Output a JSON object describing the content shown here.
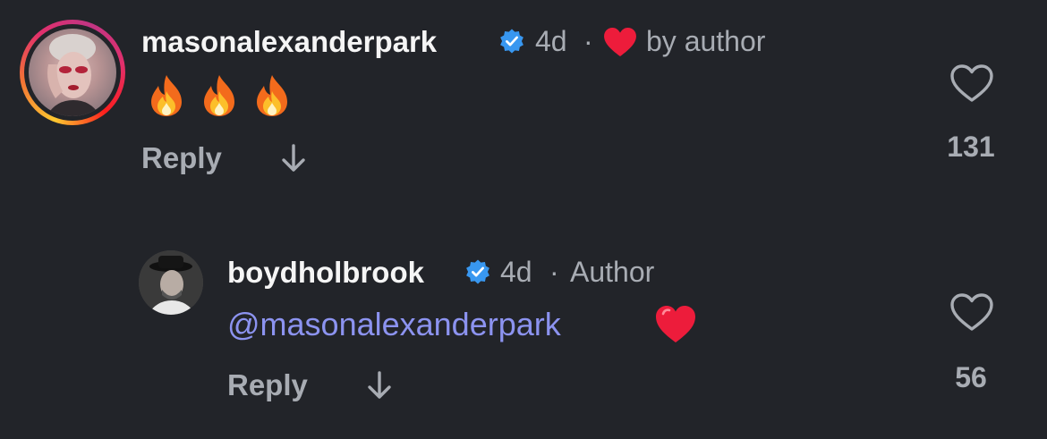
{
  "comments": [
    {
      "username": "masonalexanderpark",
      "verified": true,
      "time": "4d",
      "separator": "·",
      "liked_by_author_label": "by author",
      "body_emojis": [
        "fire-icon",
        "fire-icon",
        "fire-icon"
      ],
      "reply_label": "Reply",
      "like_count": "131",
      "has_story_ring": true
    },
    {
      "username": "boydholbrook",
      "verified": true,
      "time": "4d",
      "separator": "·",
      "role_label": "Author",
      "mention": "@masonalexanderpark",
      "body_emoji": "red-heart-icon",
      "reply_label": "Reply",
      "like_count": "56"
    }
  ],
  "colors": {
    "background": "#222429",
    "text_primary": "#f5f5f5",
    "text_secondary": "#a8acb3",
    "mention": "#8c93f0",
    "verified_badge": "#3897f0",
    "heart_red": "#ed1c3b"
  }
}
